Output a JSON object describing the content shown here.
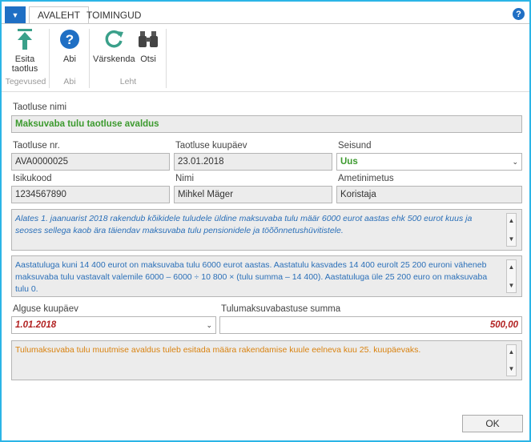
{
  "tabs": {
    "menu_icon": "chevron-down-icon",
    "home": "AVALEHT",
    "actions": "TOIMINGUD"
  },
  "ribbon": {
    "groups": [
      {
        "label": "Tegevused",
        "buttons": [
          {
            "label": "Esita taotlus",
            "icon": "arrow-up-icon"
          }
        ]
      },
      {
        "label": "Abi",
        "buttons": [
          {
            "label": "Abi",
            "icon": "help-icon"
          }
        ]
      },
      {
        "label": "Leht",
        "buttons": [
          {
            "label": "Värskenda",
            "icon": "refresh-icon"
          },
          {
            "label": "Otsi",
            "icon": "binoculars-icon"
          }
        ]
      }
    ]
  },
  "form": {
    "request_name_label": "Taotluse nimi",
    "request_name_value": "Maksuvaba tulu taotluse avaldus",
    "request_no_label": "Taotluse nr.",
    "request_no_value": "AVA0000025",
    "request_date_label": "Taotluse kuupäev",
    "request_date_value": "23.01.2018",
    "status_label": "Seisund",
    "status_value": "Uus",
    "personal_code_label": "Isikukood",
    "personal_code_value": "1234567890",
    "name_label": "Nimi",
    "name_value": "Mihkel Mäger",
    "position_label": "Ametinimetus",
    "position_value": "Koristaja",
    "info_text_1": "Alates 1. jaanuarist 2018 rakendub kõikidele tuludele üldine maksuvaba tulu määr 6000 eurot aastas ehk 500 eurot kuus ja seoses sellega kaob ära täiendav maksuvaba tulu pensionidele ja töõõnnetushüvitistele.",
    "info_text_2": "Aastatuluga kuni 14 400 eurot on maksuvaba tulu 6000 eurot aastas. Aastatulu kasvades 14 400 eurolt 25 200 euroni väheneb maksuvaba tulu vastavalt valemile 6000 – 6000 ÷ 10 800 × (tulu summa – 14 400). Aastatuluga üle 25 200 euro on maksuvaba tulu 0.",
    "start_date_label": "Alguse kuupäev",
    "start_date_value": "1.01.2018",
    "amount_label": "Tulumaksuvabastuse summa",
    "amount_value": "500,00",
    "info_text_3": "Tulumaksuvaba tulu muutmise avaldus tuleb esitada määra rakendamise kuule eelneva kuu 25. kuupäevaks."
  },
  "buttons": {
    "ok": "OK"
  },
  "colors": {
    "accent": "#1f6fc4",
    "green": "#3c9a2e",
    "red": "#b22222",
    "info_blue": "#2a6fb8",
    "info_orange": "#d9820f",
    "frame": "#2bb5e6"
  }
}
